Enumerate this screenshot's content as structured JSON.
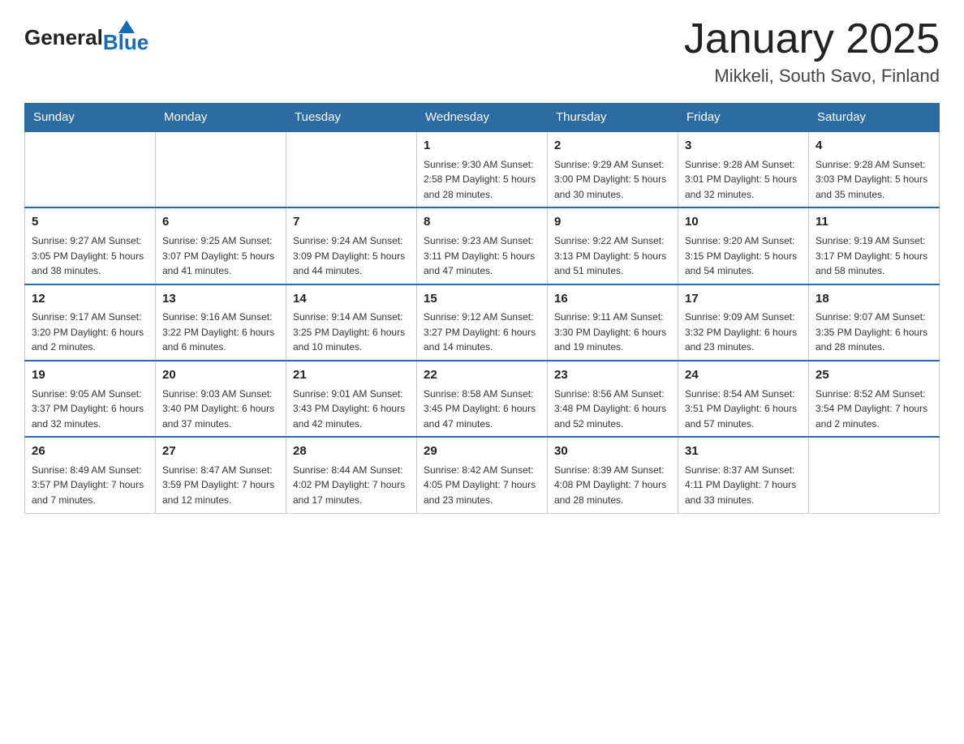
{
  "header": {
    "logo_general": "General",
    "logo_blue": "Blue",
    "month_title": "January 2025",
    "location": "Mikkeli, South Savo, Finland"
  },
  "days_of_week": [
    "Sunday",
    "Monday",
    "Tuesday",
    "Wednesday",
    "Thursday",
    "Friday",
    "Saturday"
  ],
  "weeks": [
    [
      {
        "day": "",
        "info": ""
      },
      {
        "day": "",
        "info": ""
      },
      {
        "day": "",
        "info": ""
      },
      {
        "day": "1",
        "info": "Sunrise: 9:30 AM\nSunset: 2:58 PM\nDaylight: 5 hours\nand 28 minutes."
      },
      {
        "day": "2",
        "info": "Sunrise: 9:29 AM\nSunset: 3:00 PM\nDaylight: 5 hours\nand 30 minutes."
      },
      {
        "day": "3",
        "info": "Sunrise: 9:28 AM\nSunset: 3:01 PM\nDaylight: 5 hours\nand 32 minutes."
      },
      {
        "day": "4",
        "info": "Sunrise: 9:28 AM\nSunset: 3:03 PM\nDaylight: 5 hours\nand 35 minutes."
      }
    ],
    [
      {
        "day": "5",
        "info": "Sunrise: 9:27 AM\nSunset: 3:05 PM\nDaylight: 5 hours\nand 38 minutes."
      },
      {
        "day": "6",
        "info": "Sunrise: 9:25 AM\nSunset: 3:07 PM\nDaylight: 5 hours\nand 41 minutes."
      },
      {
        "day": "7",
        "info": "Sunrise: 9:24 AM\nSunset: 3:09 PM\nDaylight: 5 hours\nand 44 minutes."
      },
      {
        "day": "8",
        "info": "Sunrise: 9:23 AM\nSunset: 3:11 PM\nDaylight: 5 hours\nand 47 minutes."
      },
      {
        "day": "9",
        "info": "Sunrise: 9:22 AM\nSunset: 3:13 PM\nDaylight: 5 hours\nand 51 minutes."
      },
      {
        "day": "10",
        "info": "Sunrise: 9:20 AM\nSunset: 3:15 PM\nDaylight: 5 hours\nand 54 minutes."
      },
      {
        "day": "11",
        "info": "Sunrise: 9:19 AM\nSunset: 3:17 PM\nDaylight: 5 hours\nand 58 minutes."
      }
    ],
    [
      {
        "day": "12",
        "info": "Sunrise: 9:17 AM\nSunset: 3:20 PM\nDaylight: 6 hours\nand 2 minutes."
      },
      {
        "day": "13",
        "info": "Sunrise: 9:16 AM\nSunset: 3:22 PM\nDaylight: 6 hours\nand 6 minutes."
      },
      {
        "day": "14",
        "info": "Sunrise: 9:14 AM\nSunset: 3:25 PM\nDaylight: 6 hours\nand 10 minutes."
      },
      {
        "day": "15",
        "info": "Sunrise: 9:12 AM\nSunset: 3:27 PM\nDaylight: 6 hours\nand 14 minutes."
      },
      {
        "day": "16",
        "info": "Sunrise: 9:11 AM\nSunset: 3:30 PM\nDaylight: 6 hours\nand 19 minutes."
      },
      {
        "day": "17",
        "info": "Sunrise: 9:09 AM\nSunset: 3:32 PM\nDaylight: 6 hours\nand 23 minutes."
      },
      {
        "day": "18",
        "info": "Sunrise: 9:07 AM\nSunset: 3:35 PM\nDaylight: 6 hours\nand 28 minutes."
      }
    ],
    [
      {
        "day": "19",
        "info": "Sunrise: 9:05 AM\nSunset: 3:37 PM\nDaylight: 6 hours\nand 32 minutes."
      },
      {
        "day": "20",
        "info": "Sunrise: 9:03 AM\nSunset: 3:40 PM\nDaylight: 6 hours\nand 37 minutes."
      },
      {
        "day": "21",
        "info": "Sunrise: 9:01 AM\nSunset: 3:43 PM\nDaylight: 6 hours\nand 42 minutes."
      },
      {
        "day": "22",
        "info": "Sunrise: 8:58 AM\nSunset: 3:45 PM\nDaylight: 6 hours\nand 47 minutes."
      },
      {
        "day": "23",
        "info": "Sunrise: 8:56 AM\nSunset: 3:48 PM\nDaylight: 6 hours\nand 52 minutes."
      },
      {
        "day": "24",
        "info": "Sunrise: 8:54 AM\nSunset: 3:51 PM\nDaylight: 6 hours\nand 57 minutes."
      },
      {
        "day": "25",
        "info": "Sunrise: 8:52 AM\nSunset: 3:54 PM\nDaylight: 7 hours\nand 2 minutes."
      }
    ],
    [
      {
        "day": "26",
        "info": "Sunrise: 8:49 AM\nSunset: 3:57 PM\nDaylight: 7 hours\nand 7 minutes."
      },
      {
        "day": "27",
        "info": "Sunrise: 8:47 AM\nSunset: 3:59 PM\nDaylight: 7 hours\nand 12 minutes."
      },
      {
        "day": "28",
        "info": "Sunrise: 8:44 AM\nSunset: 4:02 PM\nDaylight: 7 hours\nand 17 minutes."
      },
      {
        "day": "29",
        "info": "Sunrise: 8:42 AM\nSunset: 4:05 PM\nDaylight: 7 hours\nand 23 minutes."
      },
      {
        "day": "30",
        "info": "Sunrise: 8:39 AM\nSunset: 4:08 PM\nDaylight: 7 hours\nand 28 minutes."
      },
      {
        "day": "31",
        "info": "Sunrise: 8:37 AM\nSunset: 4:11 PM\nDaylight: 7 hours\nand 33 minutes."
      },
      {
        "day": "",
        "info": ""
      }
    ]
  ]
}
